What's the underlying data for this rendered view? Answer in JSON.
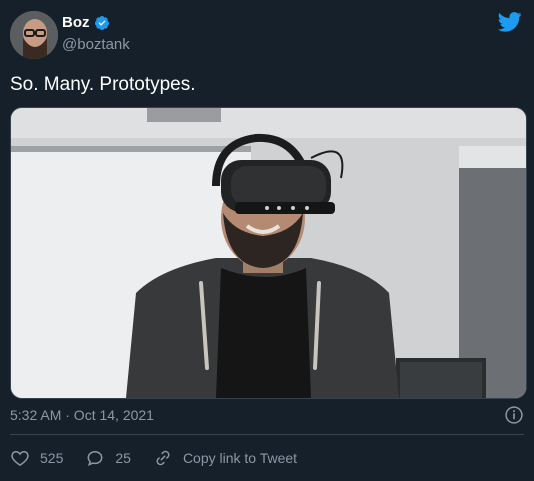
{
  "tweet": {
    "author_name": "Boz",
    "author_handle": "@boztank",
    "text": "So. Many. Prototypes.",
    "timestamp": "5:32 AM · Oct 14, 2021",
    "likes": "525",
    "replies": "25",
    "copy_link_label": "Copy link to Tweet"
  },
  "icons": {
    "verified": "verified-badge-icon",
    "brand": "twitter-bird-icon",
    "info": "info-icon",
    "like": "heart-icon",
    "reply": "reply-bubble-icon",
    "link": "link-icon"
  },
  "colors": {
    "background": "#15202b",
    "text_primary": "#ffffff",
    "text_secondary": "#8b98a5",
    "accent": "#1d9bf0"
  }
}
